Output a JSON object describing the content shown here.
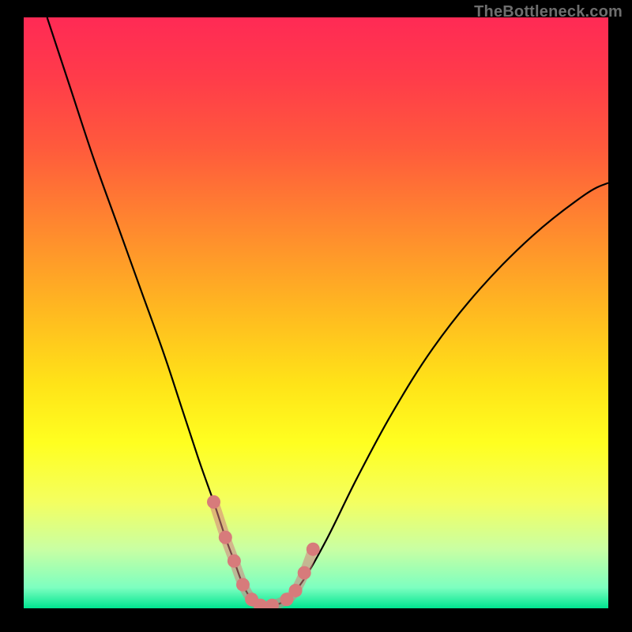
{
  "watermark": "TheBottleneck.com",
  "colors": {
    "black": "#000000",
    "curve": "#000000",
    "marker_fill": "#d77b7b",
    "marker_stroke": "#c96a6a"
  },
  "gradient_stops": [
    {
      "offset": 0.0,
      "color": "#ff2a55"
    },
    {
      "offset": 0.1,
      "color": "#ff3b4a"
    },
    {
      "offset": 0.22,
      "color": "#ff5a3c"
    },
    {
      "offset": 0.36,
      "color": "#ff8a2e"
    },
    {
      "offset": 0.5,
      "color": "#ffba20"
    },
    {
      "offset": 0.62,
      "color": "#ffe318"
    },
    {
      "offset": 0.72,
      "color": "#ffff20"
    },
    {
      "offset": 0.82,
      "color": "#f4ff60"
    },
    {
      "offset": 0.9,
      "color": "#c9ffa3"
    },
    {
      "offset": 0.965,
      "color": "#7dffc0"
    },
    {
      "offset": 1.0,
      "color": "#00e490"
    }
  ],
  "chart_data": {
    "type": "line",
    "title": "",
    "xlabel": "",
    "ylabel": "",
    "xlim": [
      0,
      100
    ],
    "ylim": [
      0,
      100
    ],
    "series": [
      {
        "name": "bottleneck-curve",
        "x": [
          4,
          8,
          12,
          16,
          20,
          24,
          27,
          30,
          32.5,
          34.5,
          36,
          37.5,
          39,
          40.5,
          42.5,
          45,
          48,
          52,
          57,
          63,
          70,
          78,
          87,
          96,
          100
        ],
        "y": [
          100,
          88,
          76,
          65,
          54,
          43,
          34,
          25,
          18,
          12,
          8,
          4,
          1.5,
          0.5,
          0.5,
          1.5,
          5,
          12,
          22,
          33,
          44,
          54,
          63,
          70,
          72
        ]
      }
    ],
    "markers": {
      "name": "bottleneck-markers",
      "x": [
        32.5,
        34.5,
        36,
        37.5,
        39,
        40.5,
        42.5,
        45,
        46.5,
        48,
        49.5
      ],
      "y": [
        18,
        12,
        8,
        4,
        1.5,
        0.5,
        0.5,
        1.5,
        3,
        6,
        10
      ]
    }
  }
}
